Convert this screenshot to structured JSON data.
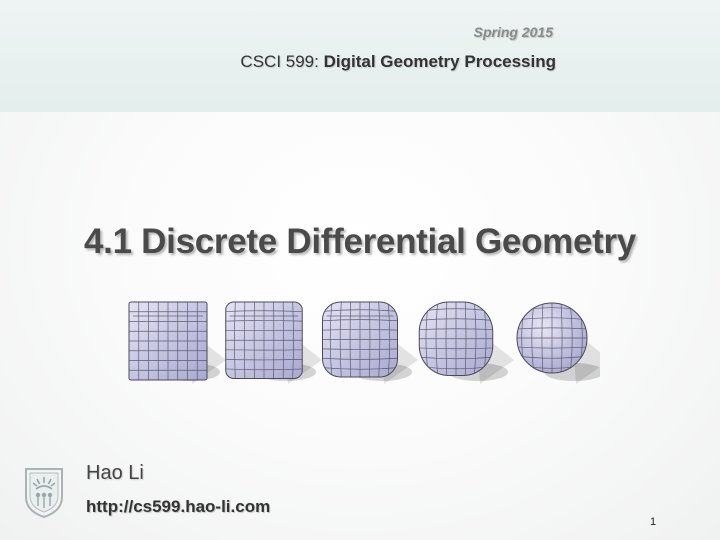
{
  "header": {
    "term": "Spring 2015",
    "course_code": "CSCI 599:",
    "course_name": "Digital Geometry Processing"
  },
  "slide": {
    "title": "4.1 Discrete Differential Geometry",
    "author": "Hao Li",
    "url": "http://cs599.hao-li.com",
    "page_number": "1"
  },
  "colors": {
    "header_bg": "#e6efed",
    "mesh_fill": "#c9c8e6",
    "mesh_lines": "#4a4a5e"
  },
  "icons": {
    "logo": "university-seal-icon"
  }
}
